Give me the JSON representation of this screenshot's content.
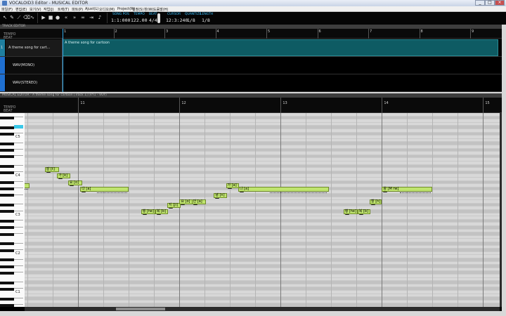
{
  "window": {
    "title": "VOCALOID3 Editor - MUSICAL EDITOR"
  },
  "menus": [
    "파일(F)",
    "편집(E)",
    "보기(V)",
    "작업(J)",
    "트랙(T)",
    "파트(P)",
    "Ajust(L)",
    "오디오(M)",
    "Project(R)",
    "설정(S)",
    "창(W)",
    "도움말(H)"
  ],
  "toolbar": {
    "song_pos_label": "SONG POS",
    "song_pos": "1:1:000",
    "tempo_label": "TEMPO",
    "tempo": "122.00",
    "beat_label": "BEAT",
    "beat": "4/4",
    "cursor_label": "CURSOR",
    "cursor": "12:3:240",
    "quantize_label": "QUANTIZE",
    "quantize": "1/8",
    "length_label": "LENGTH",
    "length": "1/8"
  },
  "track_editor": {
    "title": "TRACK EDITOR",
    "tempo_label": "TEMPO",
    "beat_label": "BEAT",
    "measures": [
      1,
      2,
      3,
      4,
      5,
      6,
      7,
      8,
      9
    ],
    "tracks": [
      {
        "num": "1",
        "name": "A theme song for cart..."
      },
      {
        "num": "",
        "name": "WAV(MONO)"
      },
      {
        "num": "",
        "name": "WAV(STEREO)"
      }
    ],
    "part_label": "A theme song for cartoon"
  },
  "musical_editor": {
    "title": "MUSICAL EDITOR - A theme song for cartoon [Track 1] (VY1 - VOY)",
    "tempo_label": "TEMPO",
    "beat_label": "BEAT",
    "measures": [
      11,
      12,
      13,
      14,
      15
    ],
    "octaves": [
      "C5",
      "C4",
      "C3",
      "C2",
      "C1"
    ],
    "notes": [
      {
        "lyric": "잘 [c]",
        "pitch": 57,
        "start": 10.0,
        "len": 0.52
      },
      {
        "lyric": "잘 [t]",
        "pitch": 62,
        "start": 10.67,
        "len": 0.14
      },
      {
        "lyric": "가 [k]",
        "pitch": 60,
        "start": 10.79,
        "len": 0.13
      },
      {
        "lyric": "요 [o]",
        "pitch": 58,
        "start": 10.9,
        "len": 0.14
      },
      {
        "lyric": "다 [a]",
        "pitch": 56,
        "start": 11.02,
        "len": 0.48
      },
      {
        "lyric": "행 [he]",
        "pitch": 49,
        "start": 11.62,
        "len": 0.14
      },
      {
        "lyric": "복 [b]",
        "pitch": 49,
        "start": 11.76,
        "len": 0.13
      },
      {
        "lyric": "지 [Ji]",
        "pitch": 51,
        "start": 11.88,
        "len": 0.13
      },
      {
        "lyric": "요 [o]",
        "pitch": 52,
        "start": 12.0,
        "len": 0.13
      },
      {
        "lyric": "안 [a]",
        "pitch": 52,
        "start": 12.12,
        "len": 0.14
      },
      {
        "lyric": "녕 [n]",
        "pitch": 54,
        "start": 12.34,
        "len": 0.13
      },
      {
        "lyric": "가 [a]",
        "pitch": 57,
        "start": 12.46,
        "len": 0.13
      },
      {
        "lyric": "나 [a]",
        "pitch": 56,
        "start": 12.58,
        "len": 0.9
      },
      {
        "lyric": "행 [he]",
        "pitch": 49,
        "start": 13.62,
        "len": 0.14
      },
      {
        "lyric": "복 [b]",
        "pitch": 49,
        "start": 13.76,
        "len": 0.13
      },
      {
        "lyric": "할 [h]",
        "pitch": 52,
        "start": 13.88,
        "len": 0.12
      },
      {
        "lyric": "왕 [M rw]",
        "pitch": 56,
        "start": 14.0,
        "len": 0.5
      }
    ]
  },
  "colors": {
    "accent": "#39c0ff",
    "note": "#bfe46e",
    "part": "#0e5b63"
  }
}
